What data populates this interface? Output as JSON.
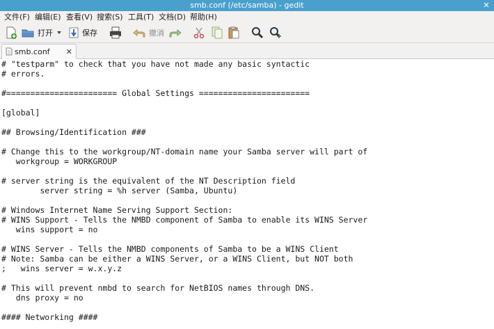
{
  "window": {
    "title": "smb.conf (/etc/samba) - gedit",
    "close_glyph": "✕"
  },
  "menu": [
    "文件(F)",
    "编辑(E)",
    "查看(V)",
    "搜索(S)",
    "工具(T)",
    "文档(D)",
    "帮助(H)"
  ],
  "toolbar": {
    "open_label": "打开",
    "save_label": "保存",
    "undo_label": "撤消",
    "icons": [
      "new-document-icon",
      "open-folder-icon",
      "dropdown-arrow-icon",
      "save-icon",
      "print-icon",
      "undo-icon",
      "redo-icon",
      "cut-icon",
      "copy-icon",
      "paste-icon",
      "search-icon",
      "replace-icon"
    ]
  },
  "tab": {
    "label": "smb.conf",
    "close_glyph": "✕"
  },
  "editor": {
    "lines": [
      "# \"testparm\" to check that you have not made any basic syntactic",
      "# errors.",
      "",
      "#======================= Global Settings =======================",
      "",
      "[global]",
      "",
      "## Browsing/Identification ###",
      "",
      "# Change this to the workgroup/NT-domain name your Samba server will part of",
      "   workgroup = WORKGROUP",
      "",
      "# server string is the equivalent of the NT Description field",
      "        server string = %h server (Samba, Ubuntu)",
      "",
      "# Windows Internet Name Serving Support Section:",
      "# WINS Support - Tells the NMBD component of Samba to enable its WINS Server",
      "   wins support = no",
      "",
      "# WINS Server - Tells the NMBD components of Samba to be a WINS Client",
      "# Note: Samba can be either a WINS Server, or a WINS Client, but NOT both",
      ";   wins server = w.x.y.z",
      "",
      "# This will prevent nmbd to search for NetBIOS names through DNS.",
      "   dns proxy = no",
      "",
      "#### Networking ####"
    ]
  }
}
